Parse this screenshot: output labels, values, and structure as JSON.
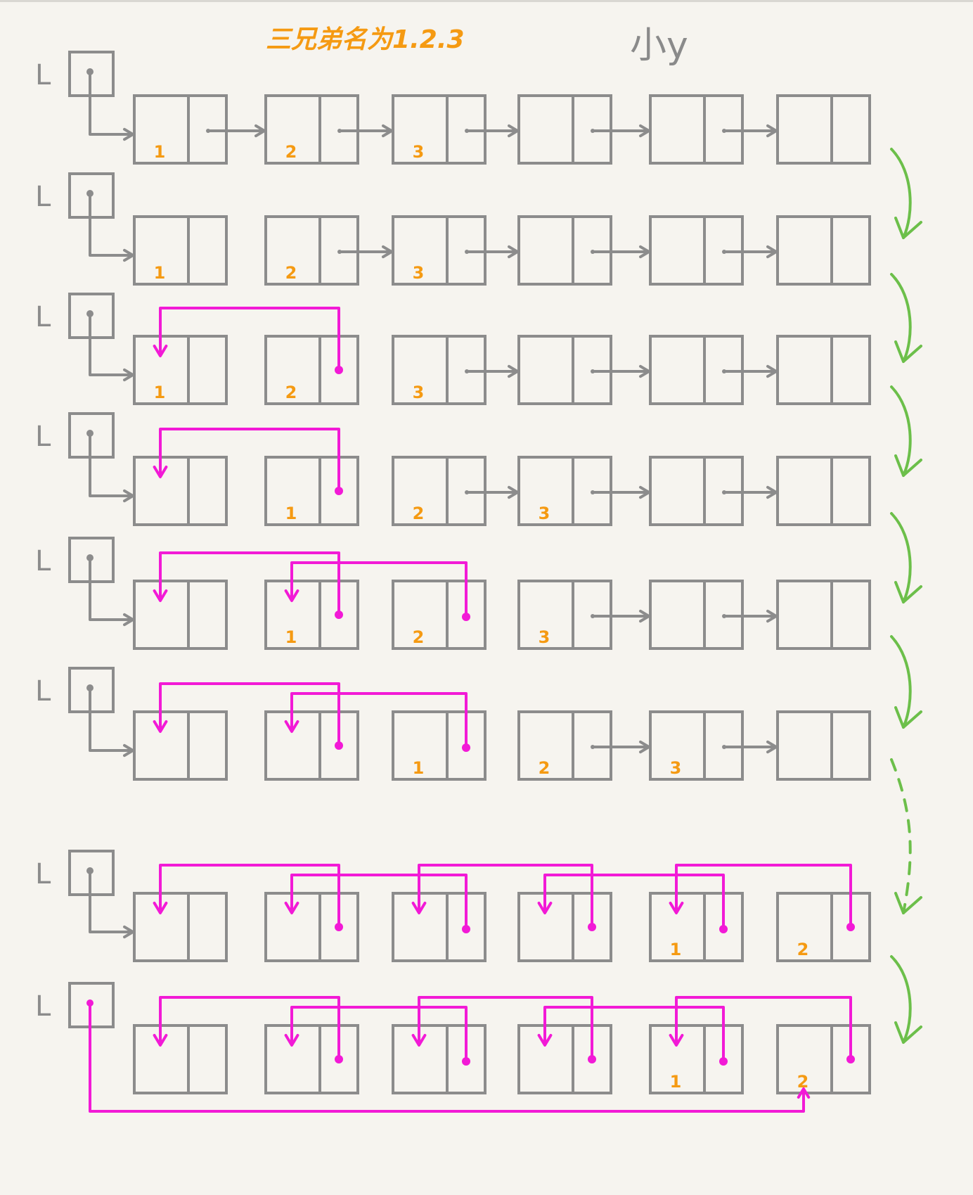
{
  "title": "三兄弟名为1.2.3",
  "author": "小y",
  "head_label": "L",
  "colors": {
    "box": "#8c8c8c",
    "normal_arrow": "#8c8c8c",
    "reversed_arrow": "#f21ad6",
    "step_arrow": "#6cbf4a",
    "number_label": "#f59a12",
    "title": "#f59a12",
    "author": "#8a8a8a",
    "background": "#f6f4ef"
  },
  "rows": [
    {
      "labels": [
        "1",
        "2",
        "3",
        "",
        "",
        ""
      ],
      "forward_links": [
        0,
        1,
        2,
        3,
        4
      ],
      "back_links": [],
      "head_target": 0,
      "head_from_last": false
    },
    {
      "labels": [
        "1",
        "2",
        "3",
        "",
        "",
        ""
      ],
      "forward_links": [
        1,
        2,
        3,
        4
      ],
      "back_links": [],
      "head_target": 0,
      "head_from_last": false
    },
    {
      "labels": [
        "1",
        "2",
        "3",
        "",
        "",
        ""
      ],
      "forward_links": [
        2,
        3,
        4
      ],
      "back_links": [
        [
          1,
          0
        ]
      ],
      "head_target": 0,
      "head_from_last": false
    },
    {
      "labels": [
        "",
        "1",
        "2",
        "3",
        "",
        ""
      ],
      "forward_links": [
        2,
        3,
        4
      ],
      "back_links": [
        [
          1,
          0
        ]
      ],
      "head_target": 0,
      "head_from_last": false
    },
    {
      "labels": [
        "",
        "1",
        "2",
        "3",
        "",
        ""
      ],
      "forward_links": [
        3,
        4
      ],
      "back_links": [
        [
          1,
          0
        ],
        [
          2,
          1
        ]
      ],
      "head_target": 0,
      "head_from_last": false
    },
    {
      "labels": [
        "",
        "",
        "1",
        "2",
        "3",
        ""
      ],
      "forward_links": [
        3,
        4
      ],
      "back_links": [
        [
          1,
          0
        ],
        [
          2,
          1
        ]
      ],
      "head_target": 0,
      "head_from_last": false
    },
    {
      "labels": [
        "",
        "",
        "",
        "",
        "1",
        "2"
      ],
      "forward_links": [],
      "back_links": [
        [
          1,
          0
        ],
        [
          2,
          1
        ],
        [
          3,
          2
        ],
        [
          4,
          3
        ],
        [
          5,
          4
        ]
      ],
      "head_target": 0,
      "head_from_last": false
    },
    {
      "labels": [
        "",
        "",
        "",
        "",
        "1",
        "2"
      ],
      "forward_links": [],
      "back_links": [
        [
          1,
          0
        ],
        [
          2,
          1
        ],
        [
          3,
          2
        ],
        [
          4,
          3
        ],
        [
          5,
          4
        ]
      ],
      "head_target": 5,
      "head_from_last": true
    }
  ],
  "transitions": [
    "solid",
    "solid",
    "solid",
    "solid",
    "solid",
    "dashed",
    "solid"
  ]
}
